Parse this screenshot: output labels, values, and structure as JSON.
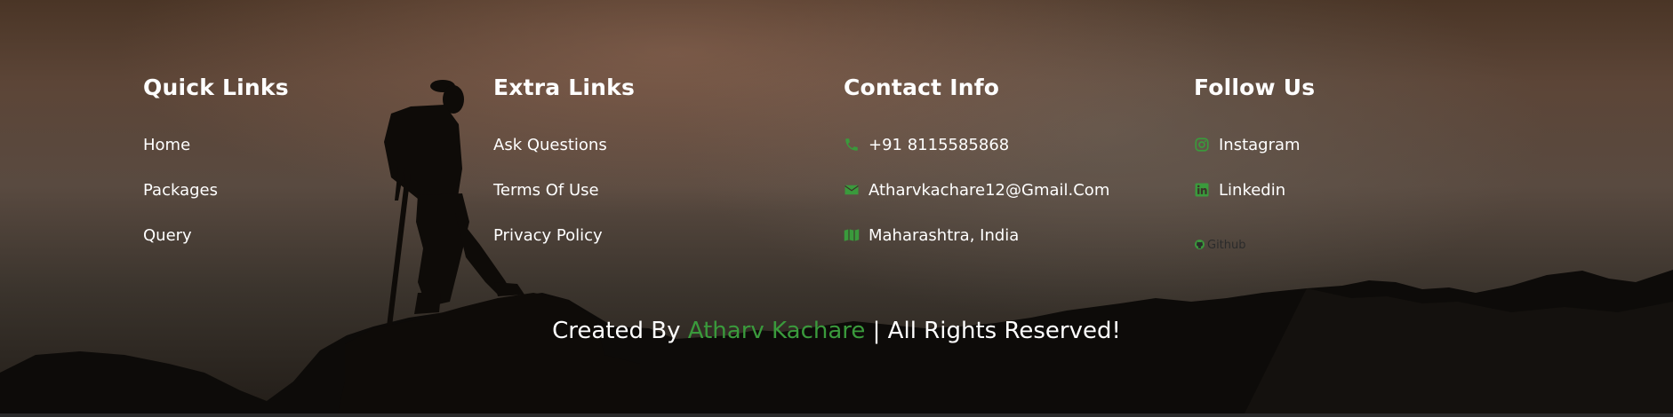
{
  "colors": {
    "accent": "#3a9a3c",
    "text": "#ffffff"
  },
  "columns": [
    {
      "heading": "Quick Links",
      "items": [
        {
          "label": "Home"
        },
        {
          "label": "Packages"
        },
        {
          "label": "Query"
        }
      ]
    },
    {
      "heading": "Extra Links",
      "items": [
        {
          "label": "Ask Questions"
        },
        {
          "label": "Terms Of Use"
        },
        {
          "label": "Privacy Policy"
        }
      ]
    },
    {
      "heading": "Contact Info",
      "items": [
        {
          "label": "+91 8115585868",
          "icon": "phone-icon"
        },
        {
          "label": "Atharvkachare12@Gmail.Com",
          "icon": "envelope-icon"
        },
        {
          "label": "Maharashtra, India",
          "icon": "map-icon"
        }
      ]
    },
    {
      "heading": "Follow Us",
      "items": [
        {
          "label": "Instagram",
          "icon": "instagram-icon"
        },
        {
          "label": "Linkedin",
          "icon": "linkedin-icon"
        },
        {
          "label": "Github",
          "icon": "github-icon"
        }
      ]
    }
  ],
  "credit": {
    "prefix": "Created By",
    "author": "Atharv Kachare",
    "suffix": "| All Rights Reserved!"
  }
}
